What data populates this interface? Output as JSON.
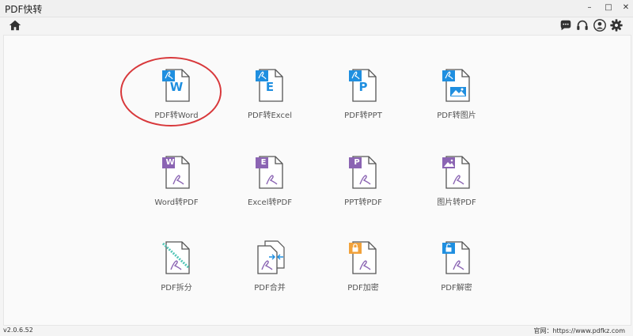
{
  "window": {
    "title": "PDF快转",
    "minimize": "–",
    "maximize": "□",
    "close": "✕"
  },
  "toolbar": {
    "home": "home-icon",
    "chat": "chat-icon",
    "support": "headset-icon",
    "account": "user-icon",
    "settings": "gear-icon"
  },
  "tiles": [
    {
      "label": "PDF转Word",
      "letter": "W"
    },
    {
      "label": "PDF转Excel",
      "letter": "E"
    },
    {
      "label": "PDF转PPT",
      "letter": "P"
    },
    {
      "label": "PDF转图片",
      "letter": ""
    },
    {
      "label": "Word转PDF",
      "letter": "W"
    },
    {
      "label": "Excel转PDF",
      "letter": "E"
    },
    {
      "label": "PPT转PDF",
      "letter": "P"
    },
    {
      "label": "图片转PDF",
      "letter": ""
    },
    {
      "label": "PDF拆分",
      "letter": ""
    },
    {
      "label": "PDF合并",
      "letter": ""
    },
    {
      "label": "PDF加密",
      "letter": ""
    },
    {
      "label": "PDF解密",
      "letter": ""
    }
  ],
  "status": {
    "version": "v2.0.6.52",
    "site": "官网：https://www.pdfkz.com"
  },
  "colors": {
    "blue": "#1f8fe0",
    "purple": "#8b64b3",
    "orange": "#f1a23b",
    "highlight": "#d8383b"
  }
}
